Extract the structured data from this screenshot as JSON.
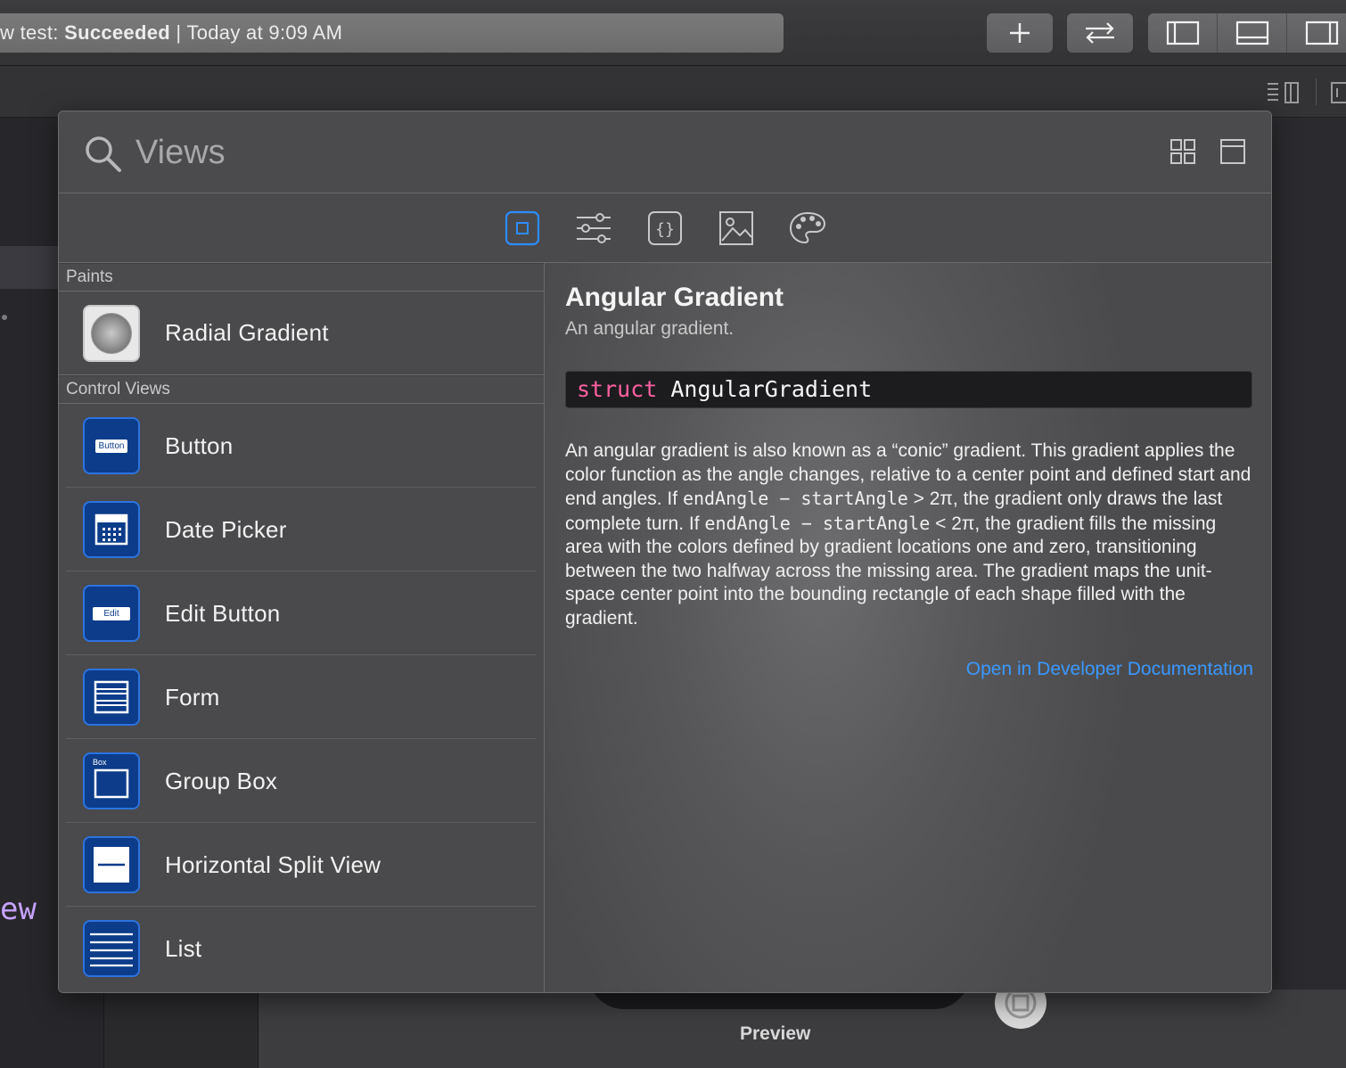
{
  "toolbar": {
    "status_prefix": "w test:",
    "status_result": "Succeeded",
    "status_separator": "|",
    "status_time": "Today at 9:09 AM",
    "add_icon": "plus-icon",
    "swap_icon": "arrows-swap-icon",
    "layout_icons": [
      "left-panel-icon",
      "bottom-panel-icon",
      "right-panel-icon"
    ]
  },
  "background": {
    "editor_fragment": "ew",
    "preview_label": "Preview"
  },
  "library": {
    "search": {
      "placeholder": "Views",
      "value": ""
    },
    "tabs": [
      {
        "icon": "views-square-icon",
        "selected": true
      },
      {
        "icon": "modifiers-sliders-icon",
        "selected": false
      },
      {
        "icon": "snippets-braces-icon",
        "selected": false
      },
      {
        "icon": "media-image-icon",
        "selected": false
      },
      {
        "icon": "colors-palette-icon",
        "selected": false
      }
    ],
    "sections": [
      {
        "header": "Paints",
        "items": [
          {
            "label": "Radial Gradient",
            "icon": "radial-gradient-icon"
          }
        ]
      },
      {
        "header": "Control Views",
        "items": [
          {
            "label": "Button",
            "icon": "button-icon",
            "badge": "Button"
          },
          {
            "label": "Date Picker",
            "icon": "date-picker-icon"
          },
          {
            "label": "Edit Button",
            "icon": "edit-button-icon",
            "badge": "Edit"
          },
          {
            "label": "Form",
            "icon": "form-icon"
          },
          {
            "label": "Group Box",
            "icon": "group-box-icon",
            "badge": "Box"
          },
          {
            "label": "Horizontal Split View",
            "icon": "horizontal-split-view-icon"
          },
          {
            "label": "List",
            "icon": "list-icon"
          }
        ]
      }
    ],
    "detail": {
      "title": "Angular Gradient",
      "subtitle": "An angular gradient.",
      "declaration_keyword": "struct",
      "declaration_name": "AngularGradient",
      "body_1": "An angular gradient is also known as a “conic” gradient. This gradient applies the color function as the angle changes, relative to a center point and defined start and end angles. If ",
      "code_1": "endAngle − startAngle",
      "body_2": " > 2π, the gradient only draws the last complete turn. If ",
      "code_2": "endAngle − startAngle",
      "body_3": " < 2π, the gradient fills the missing area with the colors defined by gradient locations one and zero, transitioning between the two halfway across the missing area. The gradient maps the unit-space center point into the bounding rectangle of each shape filled with the gradient.",
      "link": "Open in Developer Documentation"
    }
  },
  "colors": {
    "accent": "#3a98ff",
    "keyword": "#ff5fa0",
    "icon_blue": "#0c3c8a"
  }
}
